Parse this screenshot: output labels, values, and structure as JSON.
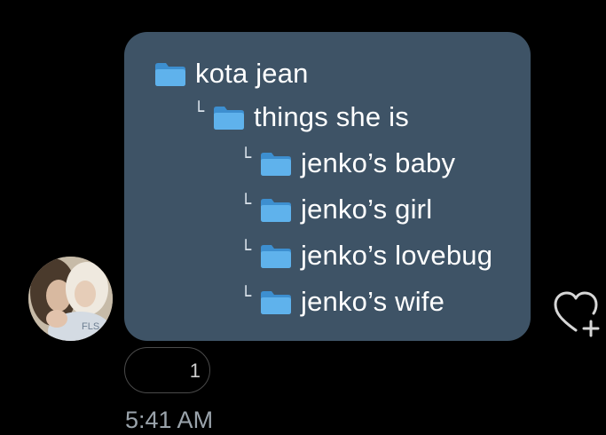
{
  "message": {
    "folders": [
      {
        "label": "kota jean",
        "level": 0
      },
      {
        "label": "things she is",
        "level": 1
      },
      {
        "label": "jenko’s baby",
        "level": 2
      },
      {
        "label": "jenko’s girl",
        "level": 2
      },
      {
        "label": "jenko’s lovebug",
        "level": 2
      },
      {
        "label": "jenko’s wife",
        "level": 2
      }
    ],
    "branch_glyph": "└",
    "reaction_count": "1",
    "timestamp": "5:41 AM",
    "avatar_text": "FLS"
  },
  "icons": {
    "folder": "folder-icon",
    "react": "heart-add-icon"
  },
  "colors": {
    "background": "#000000",
    "bubble": "#3e5366",
    "folder": "#4ea3e0",
    "timestamp": "#9aa3ab"
  }
}
